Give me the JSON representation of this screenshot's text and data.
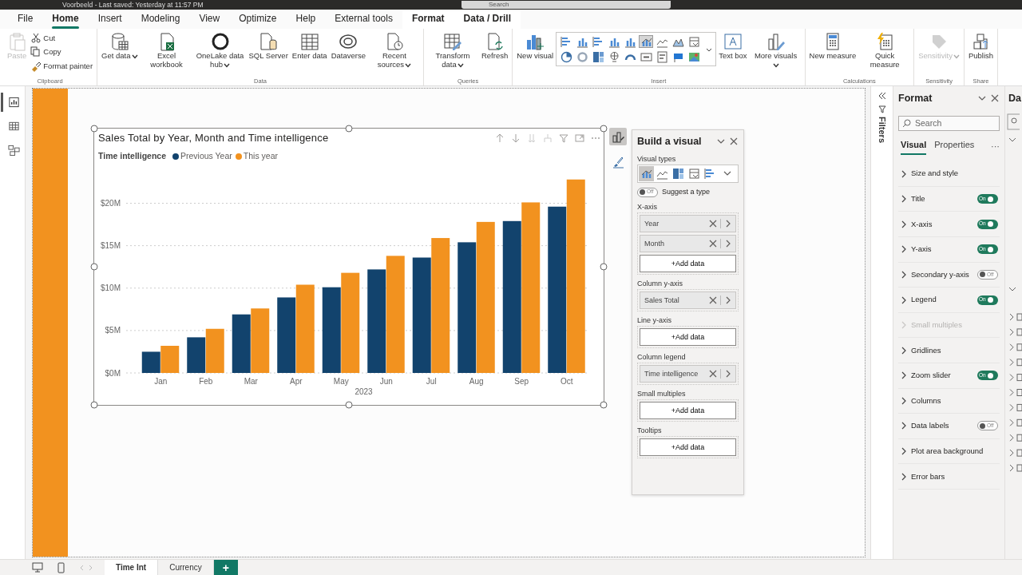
{
  "title_bar": {
    "title": "Voorbeeld - Last saved: Yesterday at 11:57 PM",
    "search": {
      "placeholder": "Search"
    }
  },
  "menu_tabs": [
    {
      "label": "File",
      "selected": false,
      "contextual": false
    },
    {
      "label": "Home",
      "selected": true,
      "contextual": false
    },
    {
      "label": "Insert",
      "selected": false,
      "contextual": false
    },
    {
      "label": "Modeling",
      "selected": false,
      "contextual": false
    },
    {
      "label": "View",
      "selected": false,
      "contextual": false
    },
    {
      "label": "Optimize",
      "selected": false,
      "contextual": false
    },
    {
      "label": "Help",
      "selected": false,
      "contextual": false
    },
    {
      "label": "External tools",
      "selected": false,
      "contextual": false
    },
    {
      "label": "Format",
      "selected": false,
      "contextual": true
    },
    {
      "label": "Data / Drill",
      "selected": false,
      "contextual": true
    }
  ],
  "ribbon": {
    "groups": [
      {
        "label": "Clipboard",
        "buttons": [
          {
            "label": "Paste",
            "kind": "large",
            "dropdown": false,
            "disabled": true
          },
          {
            "label": "Cut",
            "kind": "small",
            "disabled": false
          },
          {
            "label": "Copy",
            "kind": "small",
            "disabled": false
          },
          {
            "label": "Format painter",
            "kind": "small",
            "disabled": false
          }
        ]
      },
      {
        "label": "Data",
        "buttons": [
          {
            "label": "Get data",
            "kind": "large",
            "dropdown": true,
            "disabled": false
          },
          {
            "label": "Excel workbook",
            "kind": "large",
            "dropdown": false,
            "disabled": false
          },
          {
            "label": "OneLake data hub",
            "kind": "large",
            "dropdown": true,
            "disabled": false
          },
          {
            "label": "SQL Server",
            "kind": "large",
            "dropdown": false,
            "disabled": false
          },
          {
            "label": "Enter data",
            "kind": "large",
            "dropdown": false,
            "disabled": false
          },
          {
            "label": "Dataverse",
            "kind": "large",
            "dropdown": false,
            "disabled": false
          },
          {
            "label": "Recent sources",
            "kind": "large",
            "dropdown": true,
            "disabled": false
          }
        ]
      },
      {
        "label": "Queries",
        "buttons": [
          {
            "label": "Transform data",
            "kind": "large",
            "dropdown": true,
            "disabled": false
          },
          {
            "label": "Refresh",
            "kind": "large",
            "dropdown": false,
            "disabled": false
          }
        ]
      },
      {
        "label": "Insert",
        "buttons": [
          {
            "label": "New visual",
            "kind": "large",
            "dropdown": false,
            "disabled": false
          },
          {
            "kind": "gallery",
            "items": [
              {
                "selected": false
              },
              {
                "selected": false
              },
              {
                "selected": false
              },
              {
                "selected": false
              },
              {
                "selected": false
              },
              {
                "selected": true
              },
              {
                "selected": false
              },
              {
                "selected": false
              },
              {
                "selected": false
              },
              {
                "selected": false
              },
              {
                "selected": false
              },
              {
                "selected": false
              },
              {
                "selected": false
              },
              {
                "selected": false
              },
              {
                "selected": false
              },
              {
                "selected": false
              },
              {
                "selected": false
              },
              {
                "selected": false
              }
            ]
          },
          {
            "label": "Text box",
            "kind": "large",
            "dropdown": false,
            "disabled": false
          },
          {
            "label": "More visuals",
            "kind": "large",
            "dropdown": true,
            "disabled": false
          }
        ]
      },
      {
        "label": "Calculations",
        "buttons": [
          {
            "label": "New measure",
            "kind": "large",
            "dropdown": false,
            "disabled": false
          },
          {
            "label": "Quick measure",
            "kind": "large",
            "dropdown": false,
            "disabled": false
          }
        ]
      },
      {
        "label": "Sensitivity",
        "buttons": [
          {
            "label": "Sensitivity",
            "kind": "large",
            "dropdown": true,
            "disabled": true
          }
        ]
      },
      {
        "label": "Share",
        "buttons": [
          {
            "label": "Publish",
            "kind": "large",
            "dropdown": false,
            "disabled": false
          }
        ]
      }
    ]
  },
  "view_rail": [
    {
      "selected": true
    },
    {
      "selected": false
    },
    {
      "selected": false
    }
  ],
  "visual": {
    "legend_title": "Time intelligence",
    "chart_data": {
      "type": "bar",
      "title": "Sales Total by Year, Month and Time intelligence",
      "xlabel": "2023",
      "categories": [
        "Jan",
        "Feb",
        "Mar",
        "Apr",
        "May",
        "Jun",
        "Jul",
        "Aug",
        "Sep",
        "Oct"
      ],
      "series": [
        {
          "name": "Previous Year",
          "color": "#12436d",
          "values": [
            2.5,
            4.2,
            6.9,
            8.9,
            10.1,
            12.2,
            13.6,
            15.4,
            17.9,
            19.6
          ]
        },
        {
          "name": "This year",
          "color": "#f2921f",
          "values": [
            3.2,
            5.2,
            7.6,
            10.4,
            11.8,
            13.8,
            15.9,
            17.8,
            20.1,
            22.8
          ]
        }
      ],
      "grid": true,
      "ylim": [
        0,
        22.8
      ],
      "yticks": [
        {
          "value": 0,
          "label": "$0M"
        },
        {
          "value": 5,
          "label": "$5M"
        },
        {
          "value": 10,
          "label": "$10M"
        },
        {
          "value": 15,
          "label": "$15M"
        },
        {
          "value": 20,
          "label": "$20M"
        }
      ]
    }
  },
  "pane_switcher": [
    {
      "selected": true
    },
    {
      "selected": false
    }
  ],
  "build_pane": {
    "title": "Build a visual",
    "visual_types_label": "Visual types",
    "visual_types": [
      {
        "selected": true
      },
      {
        "selected": false
      },
      {
        "selected": false
      },
      {
        "selected": false
      },
      {
        "selected": false
      }
    ],
    "suggest": {
      "label": "Suggest a type",
      "toggle": {
        "on": false,
        "label": "Off"
      }
    },
    "wells": [
      {
        "label": "X-axis",
        "fields": [
          "Year",
          "Month"
        ],
        "add_label": "+Add data"
      },
      {
        "label": "Column y-axis",
        "fields": [
          "Sales Total"
        ]
      },
      {
        "label": "Line y-axis",
        "add_label": "+Add data"
      },
      {
        "label": "Column legend",
        "fields": [
          "Time intelligence"
        ]
      },
      {
        "label": "Small multiples",
        "add_label": "+Add data"
      },
      {
        "label": "Tooltips",
        "add_label": "+Add data"
      }
    ]
  },
  "filters_strip": {
    "label": "Filters"
  },
  "format_pane": {
    "title": "Format",
    "search": {
      "placeholder": "Search"
    },
    "tabs": [
      {
        "label": "Visual",
        "selected": true
      },
      {
        "label": "Properties",
        "selected": false
      }
    ],
    "more": "···",
    "items": [
      {
        "label": "Size and style",
        "disabled": false
      },
      {
        "label": "Title",
        "disabled": false,
        "toggle": {
          "on": true,
          "label": "On"
        }
      },
      {
        "label": "X-axis",
        "disabled": false,
        "toggle": {
          "on": true,
          "label": "On"
        }
      },
      {
        "label": "Y-axis",
        "disabled": false,
        "toggle": {
          "on": true,
          "label": "On"
        }
      },
      {
        "label": "Secondary y-axis",
        "disabled": false,
        "toggle": {
          "on": false,
          "label": "Off"
        }
      },
      {
        "label": "Legend",
        "disabled": false,
        "toggle": {
          "on": true,
          "label": "On"
        }
      },
      {
        "label": "Small multiples",
        "disabled": true
      },
      {
        "label": "Gridlines",
        "disabled": false
      },
      {
        "label": "Zoom slider",
        "disabled": false,
        "toggle": {
          "on": true,
          "label": "On"
        }
      },
      {
        "label": "Columns",
        "disabled": false
      },
      {
        "label": "Data labels",
        "disabled": false,
        "toggle": {
          "on": false,
          "label": "Off"
        }
      },
      {
        "label": "Plot area background",
        "disabled": false
      },
      {
        "label": "Error bars",
        "disabled": false
      }
    ]
  },
  "data_pane": {
    "title": "Da"
  },
  "page_tabs": [
    {
      "label": "Time Int",
      "selected": true
    },
    {
      "label": "Currency",
      "selected": false
    }
  ],
  "add_page": "+"
}
